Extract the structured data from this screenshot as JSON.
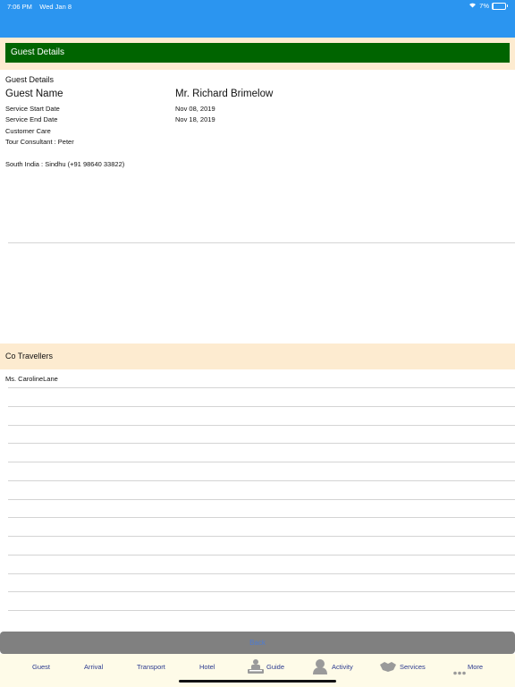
{
  "status_bar": {
    "time": "7:06 PM",
    "date": "Wed Jan 8",
    "battery": "7%",
    "battery_level": 0.07
  },
  "header": {
    "title": "Guest Details"
  },
  "guest": {
    "section_label": "Guest Details",
    "name_label": "Guest Name",
    "name_value": "Mr. Richard Brimelow",
    "service_start_label": "Service Start Date",
    "service_start_value": "Nov 08, 2019",
    "service_end_label": "Service End Date",
    "service_end_value": "Nov 18, 2019",
    "customer_care_label": "Customer Care",
    "tour_consultant": "Tour Consultant : Peter",
    "contact": "South India : Sindhu (+91 98640 33822)"
  },
  "co_travellers": {
    "title": "Co Travellers",
    "items": [
      "Ms. CarolineLane"
    ]
  },
  "back_label": "Back",
  "tabs": [
    {
      "label": "Guest",
      "icon": ""
    },
    {
      "label": "Arrival",
      "icon": ""
    },
    {
      "label": "Transport",
      "icon": ""
    },
    {
      "label": "Hotel",
      "icon": ""
    },
    {
      "label": "Guide",
      "icon": "guide-icon"
    },
    {
      "label": "Activity",
      "icon": "activity-icon"
    },
    {
      "label": "Services",
      "icon": "services-icon"
    },
    {
      "label": "More",
      "icon": "more-icon"
    }
  ]
}
